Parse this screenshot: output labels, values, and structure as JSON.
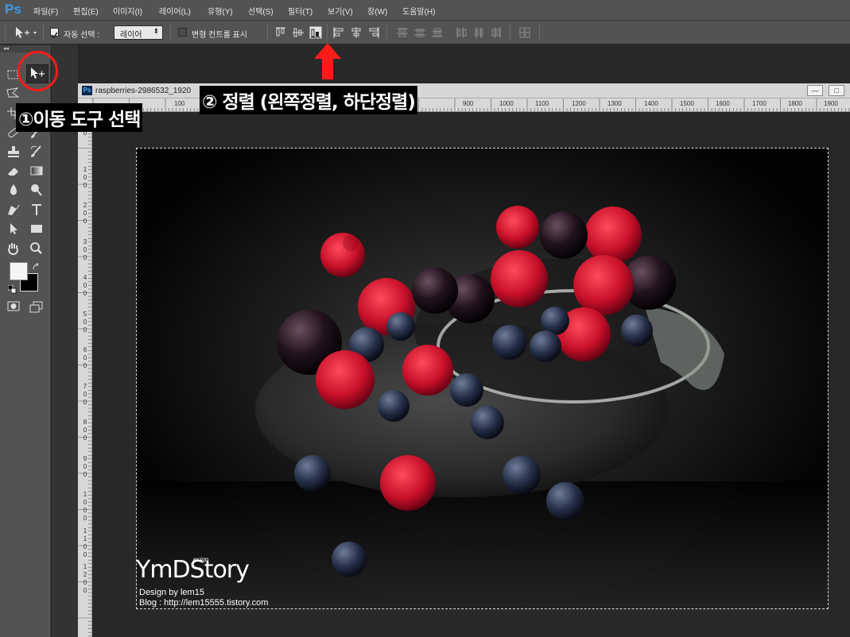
{
  "app": {
    "logo": "Ps"
  },
  "menu": [
    {
      "label": "파일(F)"
    },
    {
      "label": "편집(E)"
    },
    {
      "label": "이미지(I)"
    },
    {
      "label": "레이어(L)"
    },
    {
      "label": "유형(Y)"
    },
    {
      "label": "선택(S)"
    },
    {
      "label": "필터(T)"
    },
    {
      "label": "보기(V)"
    },
    {
      "label": "창(W)"
    },
    {
      "label": "도움말(H)"
    }
  ],
  "options": {
    "auto_select_label": "자동 선택 :",
    "auto_select_checked": true,
    "layer_select_value": "레이어",
    "transform_controls_label": "변형 컨트롤 표시",
    "transform_controls_checked": false
  },
  "document": {
    "tab_title": "raspberries-2986532_1920",
    "ps_icon": "Ps",
    "minimize": "—",
    "maximize": "□"
  },
  "ruler": {
    "h_labels": [
      "100",
      "900",
      "1000",
      "1100",
      "1200",
      "1300",
      "1400",
      "1500",
      "1600",
      "1700",
      "1800",
      "1900"
    ],
    "v_labels": [
      "0",
      "100",
      "200",
      "300",
      "400",
      "500",
      "600",
      "700",
      "800",
      "900",
      "1000",
      "1100",
      "1200"
    ]
  },
  "annotations": {
    "step1": "①이동 도구 선택",
    "step2": "② 정렬 (왼쪽정렬, 하단정렬)"
  },
  "watermark": {
    "logo": "YmDStory",
    "design_word": "esign",
    "line1": "Design by lem15",
    "line2": "Blog : http://lem15555.tistory.com"
  },
  "colors": {
    "annotation_red": "#ff1a1a",
    "ps_blue": "#3d9be9",
    "foreground": "#f4f4f4",
    "background": "#000000"
  },
  "icons": [
    "move-tool-icon",
    "marquee-icon",
    "lasso-icon",
    "crop-icon",
    "eyedropper-icon",
    "healing-icon",
    "brush-icon",
    "stamp-icon",
    "history-brush-icon",
    "eraser-icon",
    "gradient-icon",
    "blur-icon",
    "dodge-icon",
    "pen-icon",
    "type-icon",
    "path-select-icon",
    "rectangle-icon",
    "hand-icon",
    "zoom-icon"
  ]
}
